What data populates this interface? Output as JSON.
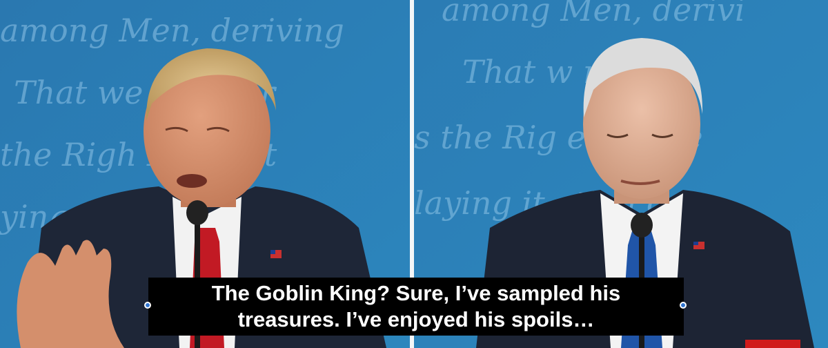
{
  "caption": {
    "line1": "The Goblin King? Sure, I’ve sampled his",
    "line2": "treasures. I’ve enjoyed his spoils…"
  },
  "backdrop": {
    "left_words": [
      "among Men, deriving",
      "That we any For",
      "the Righ People t",
      "ying"
    ],
    "right_words": [
      "among Men, derivi",
      "That w r any",
      "s the Rig e People",
      "laying it ation on"
    ]
  },
  "colors": {
    "backdrop_blue": "#2f7fb8",
    "backdrop_text": "#8ec3e6",
    "caption_bg": "#000000",
    "caption_text": "#ffffff",
    "handle": "#2f74d0"
  }
}
